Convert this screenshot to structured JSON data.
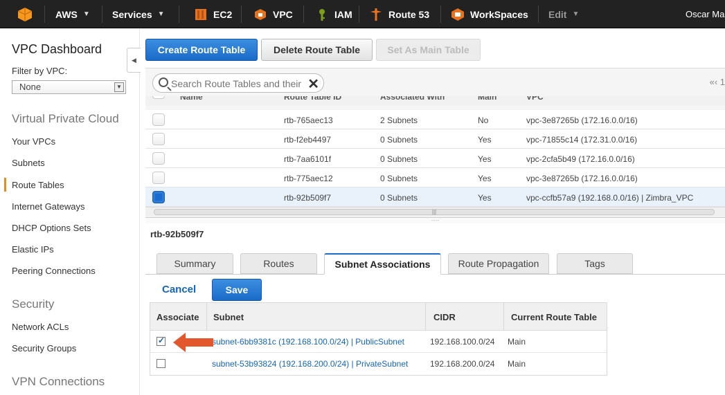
{
  "nav": {
    "aws": "AWS",
    "services": "Services",
    "shortcuts": [
      {
        "label": "EC2",
        "icon": "ec2-icon",
        "color": "#e8731f"
      },
      {
        "label": "VPC",
        "icon": "vpc-icon",
        "color": "#e8731f"
      },
      {
        "label": "IAM",
        "icon": "iam-icon",
        "color": "#7aa116"
      },
      {
        "label": "Route 53",
        "icon": "route53-icon",
        "color": "#e8731f"
      },
      {
        "label": "WorkSpaces",
        "icon": "workspaces-icon",
        "color": "#e8731f"
      }
    ],
    "edit": "Edit",
    "user": "Oscar Ma"
  },
  "sidebar": {
    "title": "VPC Dashboard",
    "filter_label": "Filter by VPC:",
    "filter_value": "None",
    "sections": [
      {
        "title": "Virtual Private Cloud",
        "items": [
          "Your VPCs",
          "Subnets",
          "Route Tables",
          "Internet Gateways",
          "DHCP Options Sets",
          "Elastic IPs",
          "Peering Connections"
        ]
      },
      {
        "title": "Security",
        "items": [
          "Network ACLs",
          "Security Groups"
        ]
      },
      {
        "title": "VPN Connections",
        "items": []
      }
    ],
    "active_item": "Route Tables"
  },
  "toolbar": {
    "create": "Create Route Table",
    "delete": "Delete Route Table",
    "set_main": "Set As Main Table"
  },
  "search": {
    "placeholder": "Search Route Tables and their"
  },
  "pager": {
    "text": "«‹ 1"
  },
  "route_tables": {
    "columns": [
      "Name",
      "Route Table ID",
      "Associated With",
      "Main",
      "VPC"
    ],
    "rows": [
      {
        "id": "rtb-765aec13",
        "assoc": "2 Subnets",
        "main": "No",
        "vpc": "vpc-3e87265b (172.16.0.0/16)",
        "selected": false
      },
      {
        "id": "rtb-f2eb4497",
        "assoc": "0 Subnets",
        "main": "Yes",
        "vpc": "vpc-71855c14 (172.31.0.0/16)",
        "selected": false
      },
      {
        "id": "rtb-7aa6101f",
        "assoc": "0 Subnets",
        "main": "Yes",
        "vpc": "vpc-2cfa5b49 (172.16.0.0/16)",
        "selected": false
      },
      {
        "id": "rtb-775aec12",
        "assoc": "0 Subnets",
        "main": "Yes",
        "vpc": "vpc-3e87265b (172.16.0.0/16)",
        "selected": false
      },
      {
        "id": "rtb-92b509f7",
        "assoc": "0 Subnets",
        "main": "Yes",
        "vpc": "vpc-ccfb57a9 (192.168.0.0/16) | Zimbra_VPC",
        "selected": true
      }
    ]
  },
  "detail": {
    "title": "rtb-92b509f7",
    "tabs": [
      "Summary",
      "Routes",
      "Subnet Associations",
      "Route Propagation",
      "Tags"
    ],
    "active_tab": "Subnet Associations",
    "cancel": "Cancel",
    "save": "Save",
    "subnet_table": {
      "columns": [
        "Associate",
        "Subnet",
        "CIDR",
        "Current Route Table"
      ],
      "rows": [
        {
          "checked": true,
          "subnet": "subnet-6bb9381c (192.168.100.0/24) | PublicSubnet",
          "cidr": "192.168.100.0/24",
          "current": "Main"
        },
        {
          "checked": false,
          "subnet": "subnet-53b93824 (192.168.200.0/24) | PrivateSubnet",
          "cidr": "192.168.200.0/24",
          "current": "Main"
        }
      ]
    }
  },
  "colors": {
    "accent": "#1a6bc8",
    "arrow": "#e2582c",
    "aws_orange": "#f7981d"
  }
}
